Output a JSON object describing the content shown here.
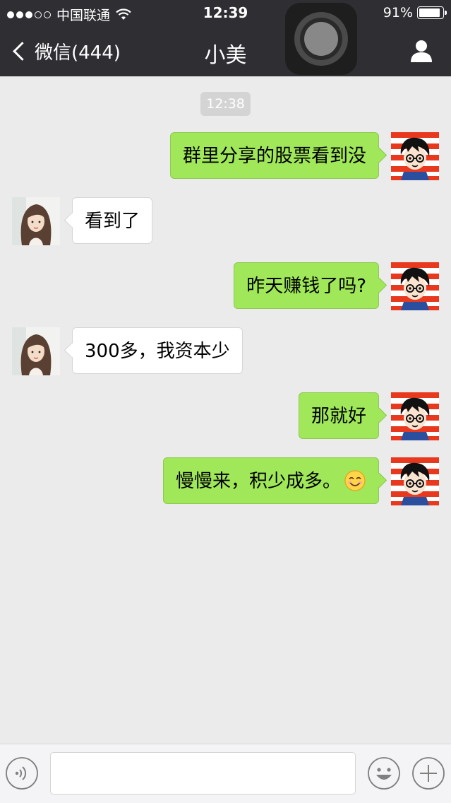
{
  "status_bar": {
    "carrier": "中国联通",
    "time": "12:39",
    "battery_text": "91%",
    "battery_level": 0.91,
    "signal_bars_filled": 3,
    "signal_bars_total": 5,
    "wifi_icon": "wifi-icon"
  },
  "nav": {
    "back_label": "微信(444)",
    "title": "小美",
    "profile_icon": "person-icon"
  },
  "chat": {
    "timestamp": "12:38",
    "messages": [
      {
        "side": "right",
        "text": "群里分享的股票看到没"
      },
      {
        "side": "left",
        "text": "看到了"
      },
      {
        "side": "right",
        "text": "昨天赚钱了吗?"
      },
      {
        "side": "left",
        "text": "300多，我资本少"
      },
      {
        "side": "right",
        "text": "那就好"
      },
      {
        "side": "right",
        "text": "慢慢来，积少成多。",
        "emoji": "smiling-face-emoji"
      }
    ]
  },
  "input_bar": {
    "placeholder": "",
    "value": "",
    "voice_icon": "voice-icon",
    "emoji_icon": "emoji-icon",
    "plus_icon": "plus-icon"
  },
  "colors": {
    "nav_background": "#2e2e33",
    "chat_background": "#ebebeb",
    "my_bubble": "#a0e75a",
    "their_bubble": "#ffffff"
  }
}
